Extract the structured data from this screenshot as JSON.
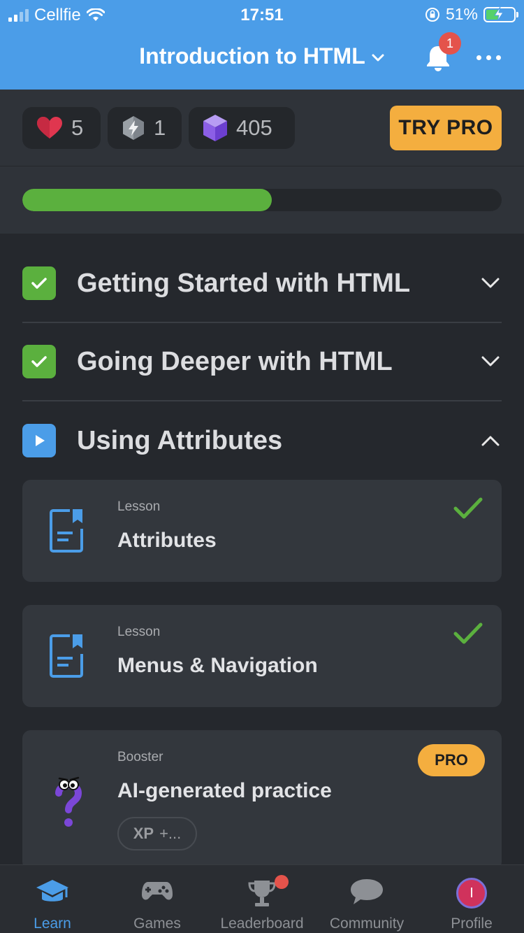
{
  "status": {
    "carrier": "Cellfie",
    "time": "17:51",
    "battery_percent": "51%",
    "battery_level": 0.51
  },
  "header": {
    "title": "Introduction to HTML",
    "notification_count": "1"
  },
  "stats": {
    "hearts": "5",
    "energy": "1",
    "gems": "405",
    "try_pro_label": "TRY PRO"
  },
  "progress": {
    "fraction": 0.52
  },
  "modules": [
    {
      "title": "Getting Started with HTML",
      "state": "complete",
      "expanded": false
    },
    {
      "title": "Going Deeper with HTML",
      "state": "complete",
      "expanded": false
    },
    {
      "title": "Using Attributes",
      "state": "in-progress",
      "expanded": true
    }
  ],
  "items": [
    {
      "kind": "Lesson",
      "title": "Attributes",
      "completed": true
    },
    {
      "kind": "Lesson",
      "title": "Menus & Navigation",
      "completed": true
    },
    {
      "kind": "Booster",
      "title": "AI-generated practice",
      "badge": "PRO",
      "xp_label": "XP",
      "xp_value": "+..."
    }
  ],
  "tabs": [
    {
      "label": "Learn",
      "icon": "graduation-cap-icon",
      "active": true
    },
    {
      "label": "Games",
      "icon": "gamepad-icon",
      "active": false
    },
    {
      "label": "Leaderboard",
      "icon": "trophy-icon",
      "active": false
    },
    {
      "label": "Community",
      "icon": "chat-bubble-icon",
      "active": false
    },
    {
      "label": "Profile",
      "icon": "avatar",
      "active": false,
      "avatar_letter": "I"
    }
  ],
  "colors": {
    "header_blue": "#4b9de8",
    "success_green": "#5bb03e",
    "pro_orange": "#f4ae3f",
    "badge_red": "#e4534b"
  }
}
